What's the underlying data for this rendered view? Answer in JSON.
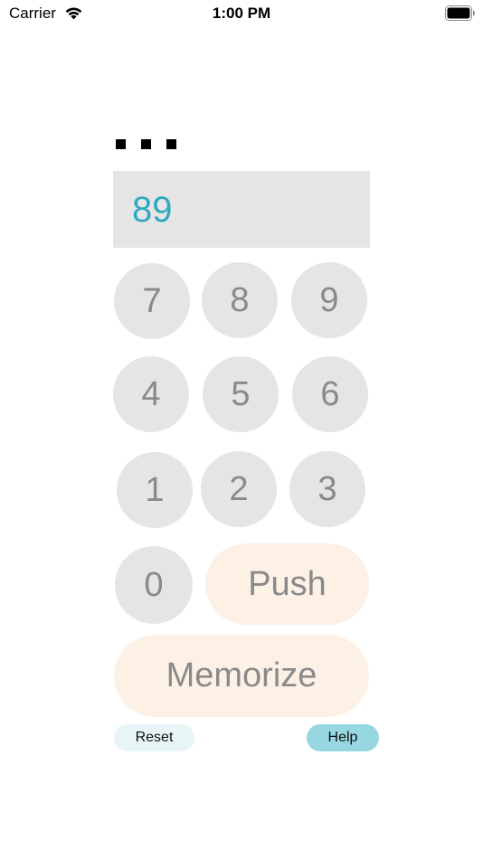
{
  "status_bar": {
    "carrier": "Carrier",
    "time": "1:00 PM",
    "wifi_icon": "wifi-icon",
    "battery_icon": "battery-icon"
  },
  "entry": {
    "dots_count": 3,
    "display_value": "89"
  },
  "keypad": {
    "keys": [
      "7",
      "8",
      "9",
      "4",
      "5",
      "6",
      "1",
      "2",
      "3",
      "0"
    ],
    "push_label": "Push",
    "memorize_label": "Memorize"
  },
  "footer": {
    "reset_label": "Reset",
    "help_label": "Help"
  },
  "colors": {
    "display_text": "#2fa9c2",
    "key_background": "#e5e5e5",
    "key_text": "#8a8a8a",
    "pill_background": "#fdf1e6",
    "reset_background": "#e8f5f6",
    "help_background": "#96d7e0"
  }
}
